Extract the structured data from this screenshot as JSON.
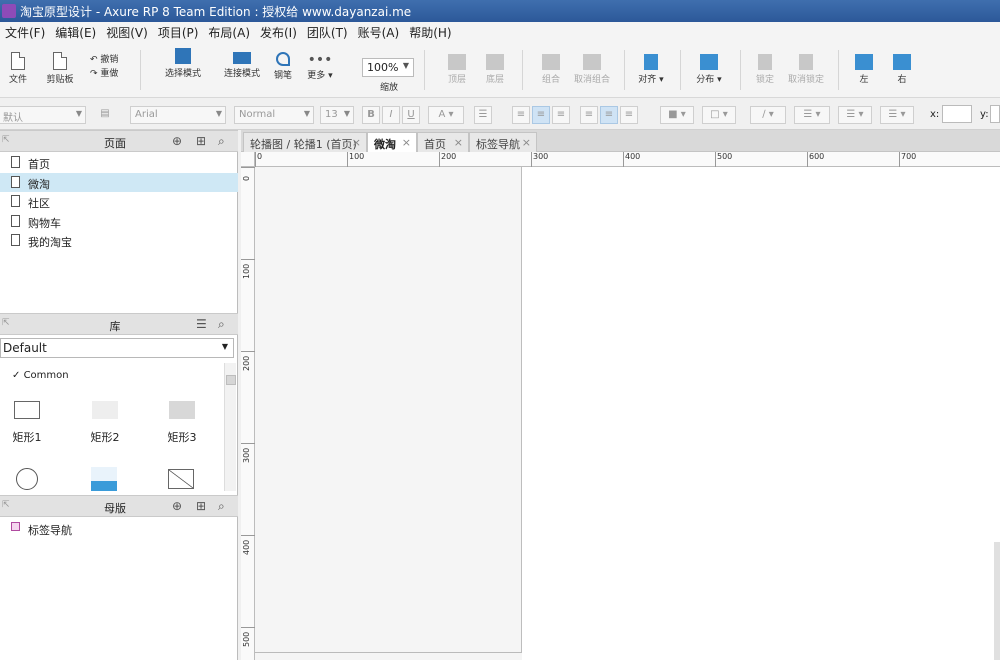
{
  "window": {
    "title": "淘宝原型设计 - Axure RP 8 Team Edition : 授权给 www.dayanzai.me"
  },
  "menu": [
    "文件(F)",
    "编辑(E)",
    "视图(V)",
    "项目(P)",
    "布局(A)",
    "发布(I)",
    "团队(T)",
    "账号(A)",
    "帮助(H)"
  ],
  "toolbar": {
    "file": "文件",
    "clipboard": "剪贴板",
    "undo": "撤销",
    "redo": "重做",
    "select_mode": "选择模式",
    "connect_mode": "连接模式",
    "pen": "钢笔",
    "more": "更多",
    "zoom_value": "100%",
    "zoom_label": "缩放",
    "top": "顶层",
    "bottom": "底层",
    "group": "组合",
    "ungroup": "取消组合",
    "align": "对齐",
    "distribute": "分布",
    "lock": "锁定",
    "unlock": "取消锁定",
    "left": "左",
    "right": "右"
  },
  "format": {
    "style": "默认",
    "font": "Arial",
    "weight": "Normal",
    "size": "13",
    "bold": "B",
    "italic": "I",
    "underline": "U",
    "x_label": "x:",
    "y_label": "y:"
  },
  "pages_panel": {
    "title": "页面",
    "items": [
      {
        "label": "首页",
        "selected": false
      },
      {
        "label": "微淘",
        "selected": true
      },
      {
        "label": "社区",
        "selected": false
      },
      {
        "label": "购物车",
        "selected": false
      },
      {
        "label": "我的淘宝",
        "selected": false
      }
    ]
  },
  "library_panel": {
    "title": "库",
    "selected_library": "Default",
    "section": "Common",
    "widgets": [
      "矩形1",
      "矩形2",
      "矩形3"
    ]
  },
  "masters_panel": {
    "title": "母版",
    "items": [
      "标签导航"
    ]
  },
  "tabs": [
    {
      "label": "轮播图 / 轮播1 (首页)",
      "active": false
    },
    {
      "label": "微淘",
      "active": true
    },
    {
      "label": "首页",
      "active": false
    },
    {
      "label": "标签导航",
      "active": false
    }
  ],
  "ruler": {
    "top": [
      "0",
      "100",
      "200",
      "300",
      "400",
      "500",
      "600",
      "700"
    ],
    "left": [
      "0",
      "100",
      "200",
      "300",
      "400",
      "500"
    ]
  }
}
